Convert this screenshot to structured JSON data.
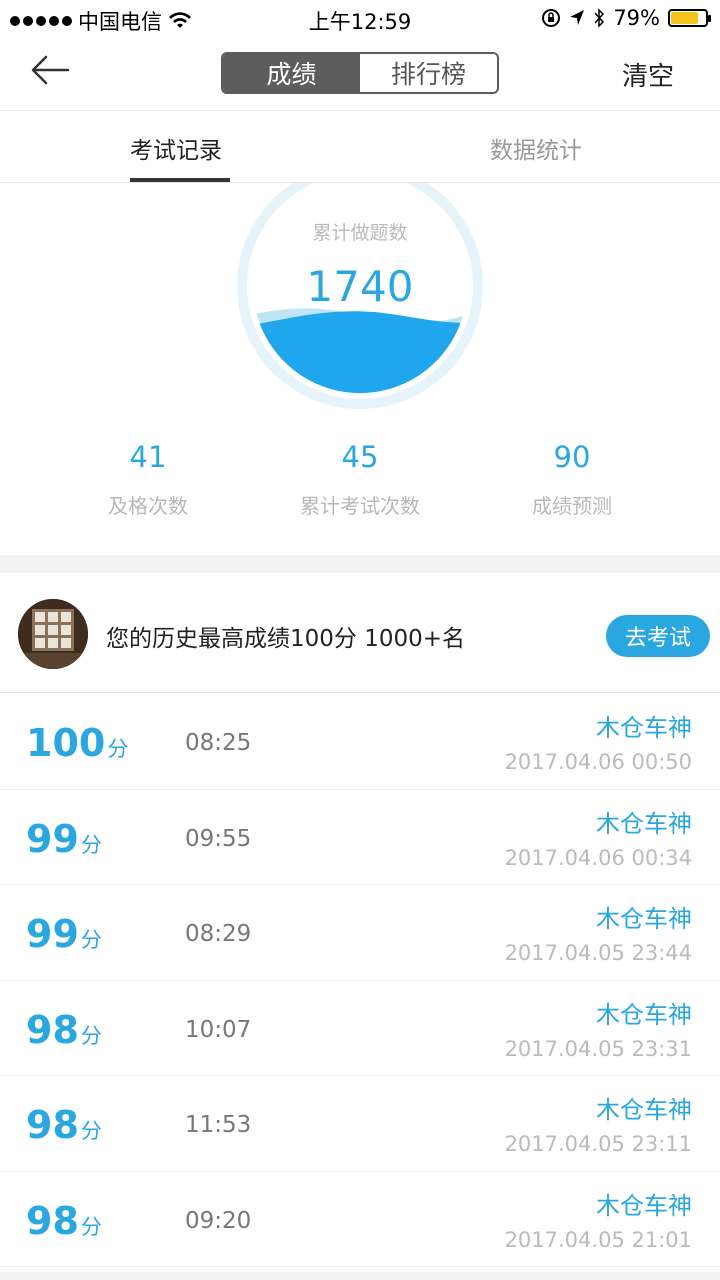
{
  "status_bar": {
    "carrier": "中国电信",
    "time": "上午12:59",
    "battery": "79%",
    "battery_level": 0.79
  },
  "nav": {
    "back_icon": "back-arrow-icon",
    "segments": [
      "成绩",
      "排行榜"
    ],
    "active_segment": "成绩",
    "clear_label": "清空"
  },
  "tabs": {
    "items": [
      "考试记录",
      "数据统计"
    ],
    "active": "考试记录"
  },
  "gauge": {
    "label": "累计做题数",
    "value": "1740",
    "accent": "#2aa7e0"
  },
  "stats": [
    {
      "value": "41",
      "label": "及格次数"
    },
    {
      "value": "45",
      "label": "累计考试次数"
    },
    {
      "value": "90",
      "label": "成绩预测"
    }
  ],
  "best": {
    "text": "您的历史最高成绩100分 1000+名",
    "button": "去考试"
  },
  "records": [
    {
      "score": "100",
      "unit": "分",
      "duration": "08:25",
      "name": "木仓车神",
      "time": "2017.04.06 00:50"
    },
    {
      "score": "99",
      "unit": "分",
      "duration": "09:55",
      "name": "木仓车神",
      "time": "2017.04.06 00:34"
    },
    {
      "score": "99",
      "unit": "分",
      "duration": "08:29",
      "name": "木仓车神",
      "time": "2017.04.05 23:44"
    },
    {
      "score": "98",
      "unit": "分",
      "duration": "10:07",
      "name": "木仓车神",
      "time": "2017.04.05 23:31"
    },
    {
      "score": "98",
      "unit": "分",
      "duration": "11:53",
      "name": "木仓车神",
      "time": "2017.04.05 23:11"
    },
    {
      "score": "98",
      "unit": "分",
      "duration": "09:20",
      "name": "木仓车神",
      "time": "2017.04.05 21:01"
    }
  ]
}
